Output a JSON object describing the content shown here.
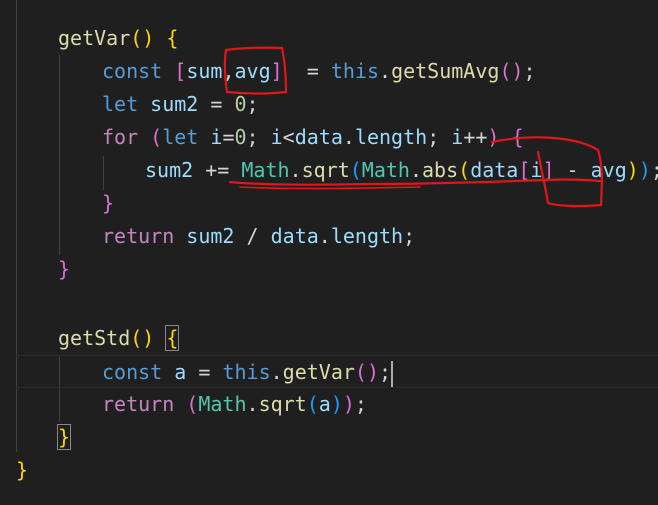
{
  "code": {
    "method1_name": "getVar",
    "kw_const": "const",
    "kw_let": "let",
    "kw_for": "for",
    "kw_return": "return",
    "kw_this": "this",
    "var_sum": "sum",
    "var_avg": "avg",
    "var_sum2": "sum2",
    "var_i": "i",
    "var_data": "data",
    "prop_length": "length",
    "fn_getSumAvg": "getSumAvg",
    "cls_Math": "Math",
    "fn_sqrt": "sqrt",
    "fn_abs": "abs",
    "num_zero": "0",
    "method2_name": "getStd",
    "var_a": "a",
    "fn_getVar": "getVar",
    "colors": {
      "background": "#1f1f1f",
      "keyword": "#569cd6",
      "control": "#c586c0",
      "function": "#dcdcaa",
      "variable": "#9cdcfe",
      "class": "#4ec9b0",
      "number": "#b5cea8",
      "annotation_ink": "#e0161b"
    }
  }
}
